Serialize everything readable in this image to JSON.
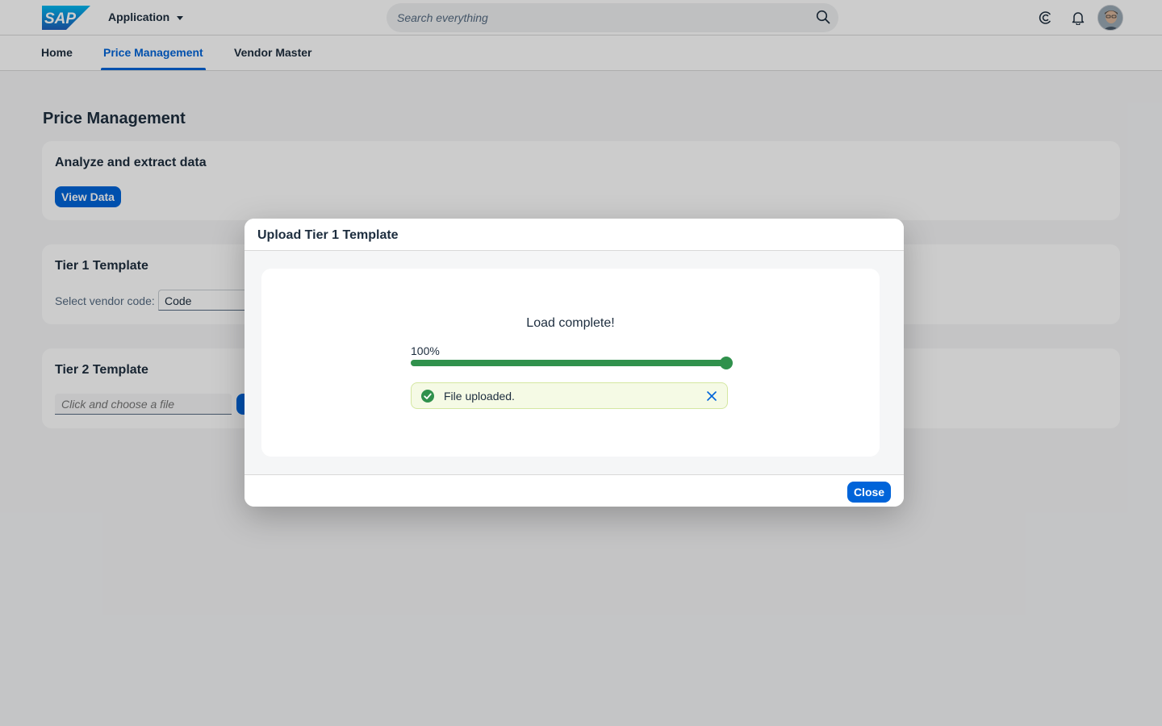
{
  "shell": {
    "logo_text": "SAP",
    "app_title": "Application",
    "search_placeholder": "Search everything",
    "brand_color": "#0a6ed1"
  },
  "tabs": [
    {
      "label": "Home",
      "selected": false
    },
    {
      "label": "Price Management",
      "selected": true
    },
    {
      "label": "Vendor Master",
      "selected": false
    }
  ],
  "page": {
    "title": "Price Management",
    "analyze": {
      "title": "Analyze and extract data",
      "button_label": "View Data"
    },
    "tier1": {
      "title": "Tier 1 Template",
      "vendor_label": "Select vendor code:",
      "vendor_value": "Code"
    },
    "tier2": {
      "title": "Tier 2 Template",
      "file_placeholder": "Click and choose a file"
    }
  },
  "dialog": {
    "title": "Upload Tier 1 Template",
    "message": "Load complete!",
    "progress_label": "100%",
    "progress_percent": 100,
    "status_text": "File uploaded.",
    "status_color": "#30914c",
    "close_label": "Close"
  }
}
